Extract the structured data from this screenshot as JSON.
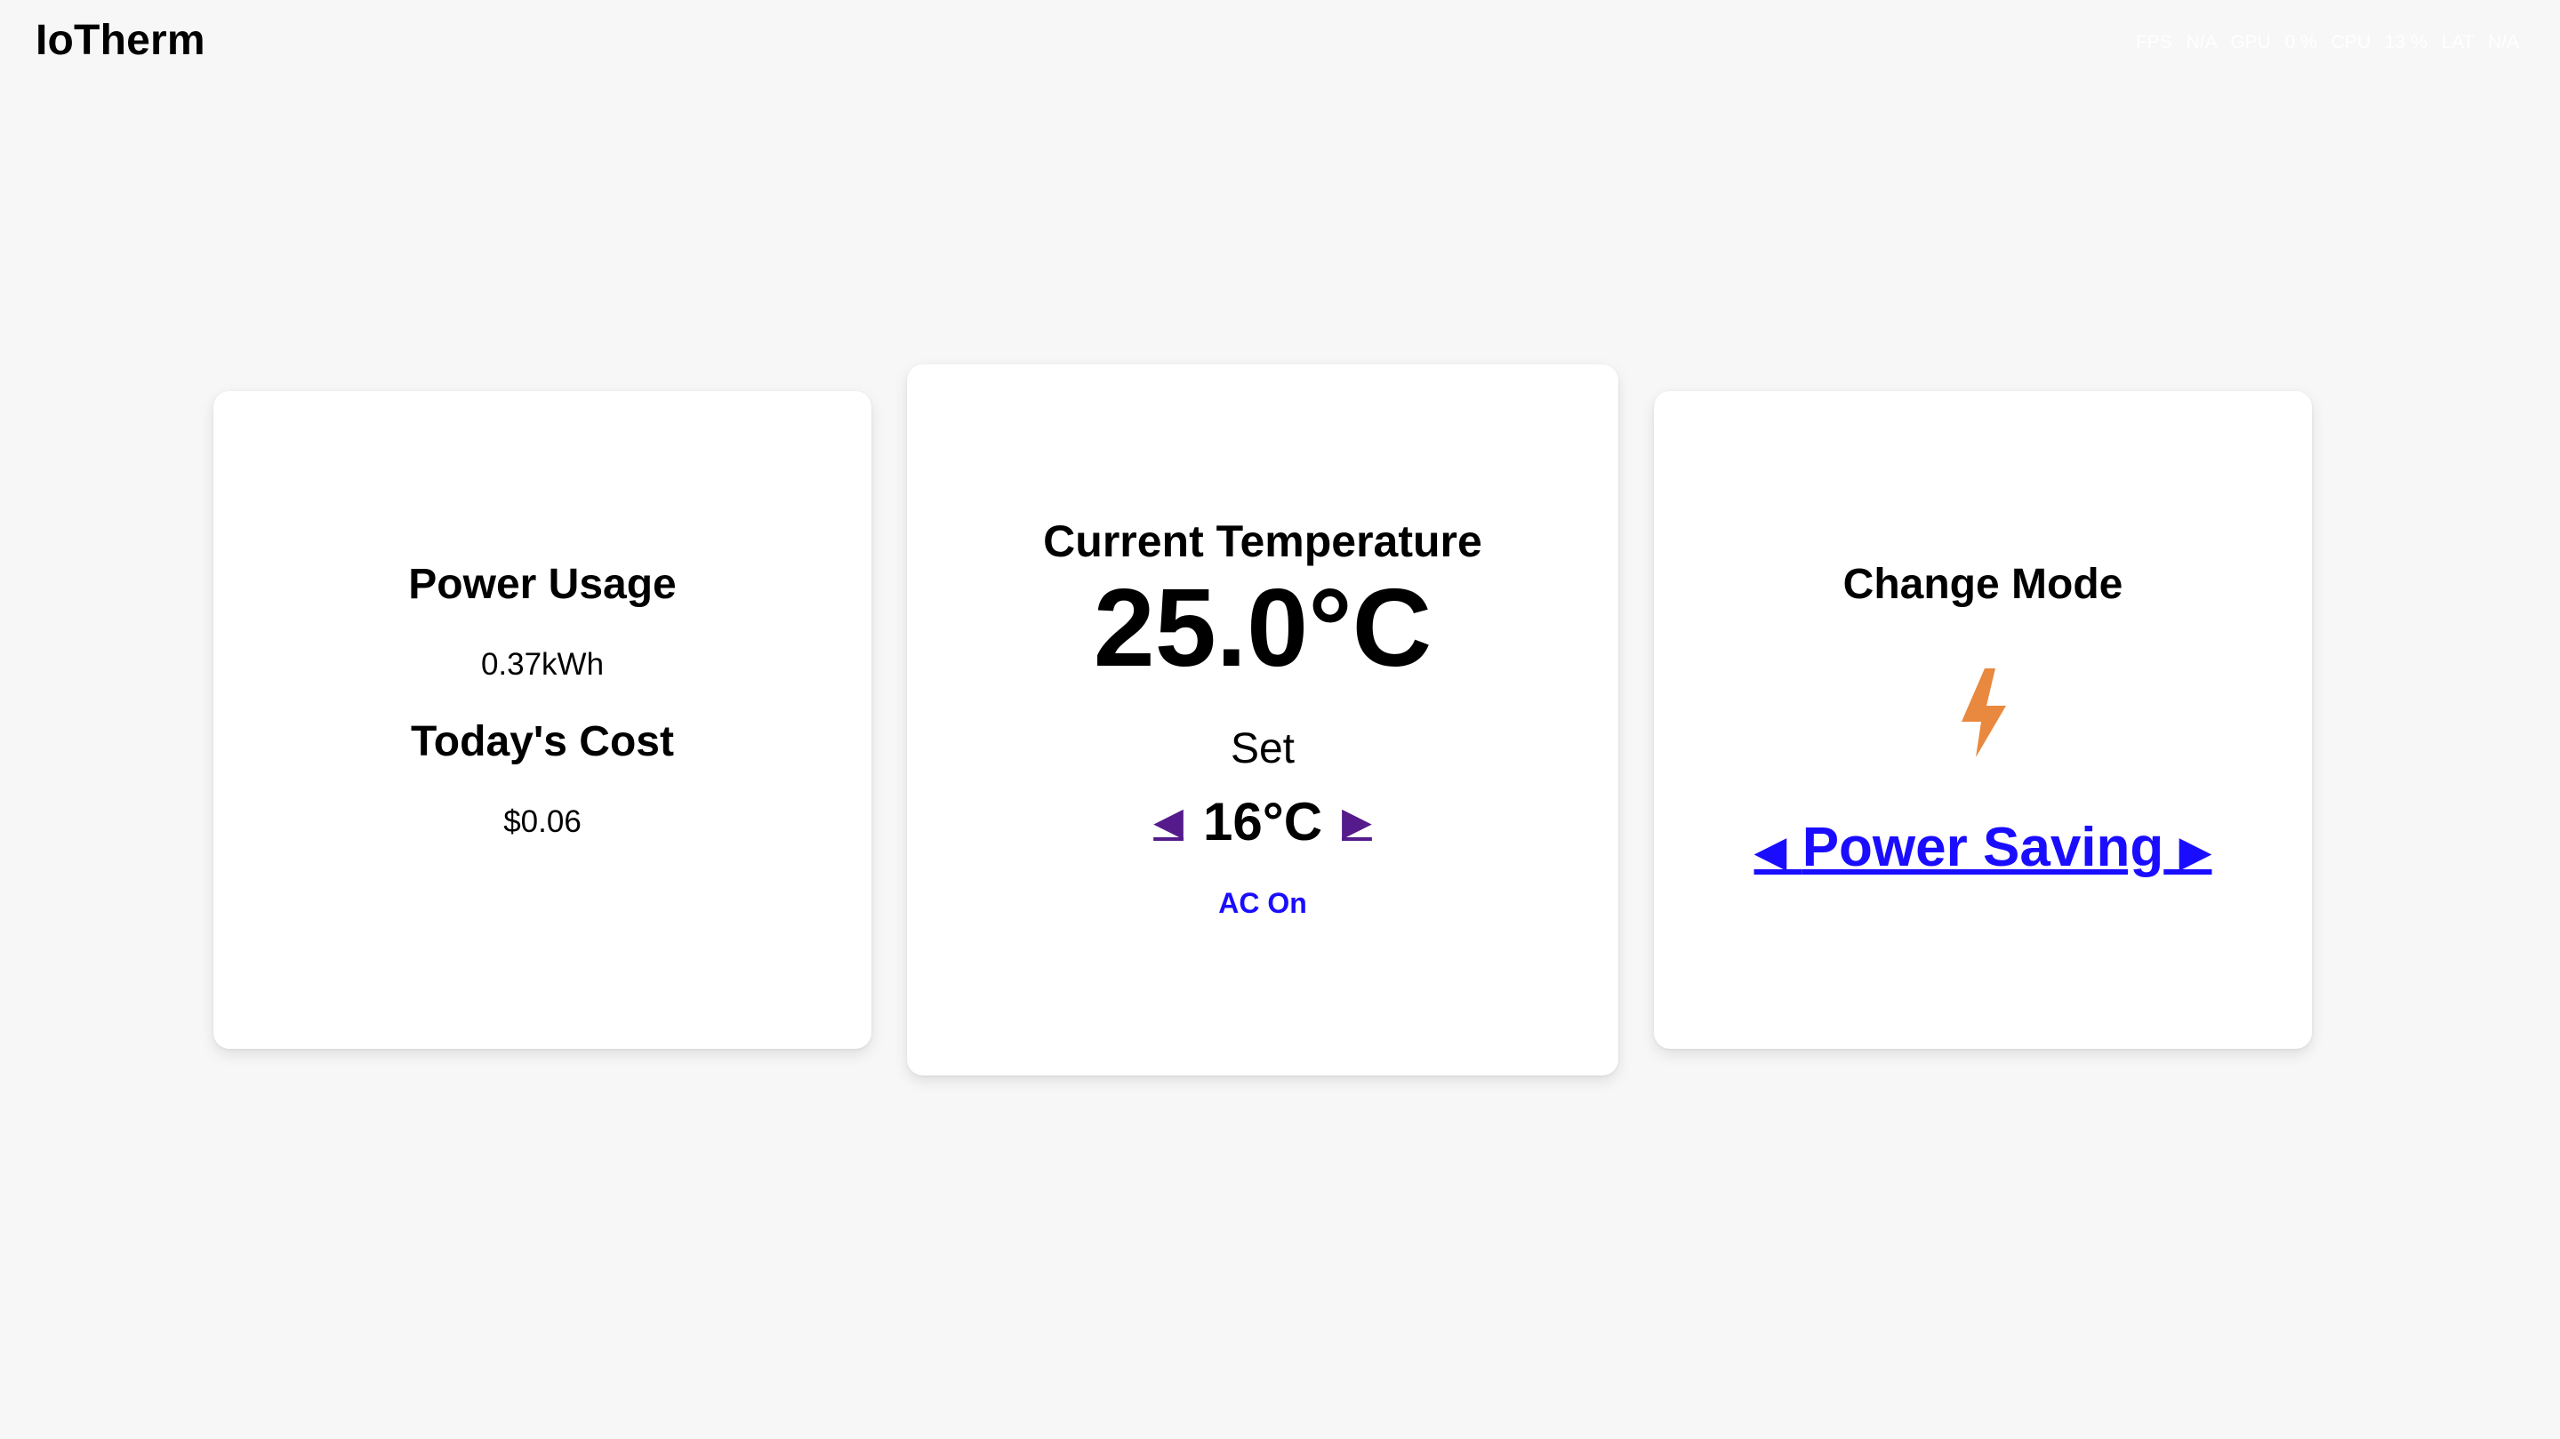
{
  "header": {
    "app_title": "IoTherm",
    "stats": {
      "fps_label": "FPS",
      "fps_value": "N/A",
      "gpu_label": "GPU",
      "gpu_value": "0 %",
      "cpu_label": "CPU",
      "cpu_value": "13 %",
      "lat_label": "LAT",
      "lat_value": "N/A"
    }
  },
  "power_card": {
    "power_title": "Power Usage",
    "power_value": "0.37kWh",
    "cost_title": "Today's Cost",
    "cost_value": "$0.06"
  },
  "temperature_card": {
    "title": "Current Temperature",
    "current": "25.0°C",
    "set_label": "Set",
    "decrease_arrow": "◀",
    "set_value": "16°C",
    "increase_arrow": "▶",
    "status": "AC On"
  },
  "mode_card": {
    "title": "Change Mode",
    "icon": "lightning-bolt-icon",
    "prev_arrow": "◀",
    "mode": "Power Saving",
    "next_arrow": "▶"
  },
  "colors": {
    "background": "#f7f7f7",
    "card": "#ffffff",
    "link_blue": "#1a0dff",
    "visited_purple": "#551a8b",
    "bolt_orange": "#e8893f"
  }
}
